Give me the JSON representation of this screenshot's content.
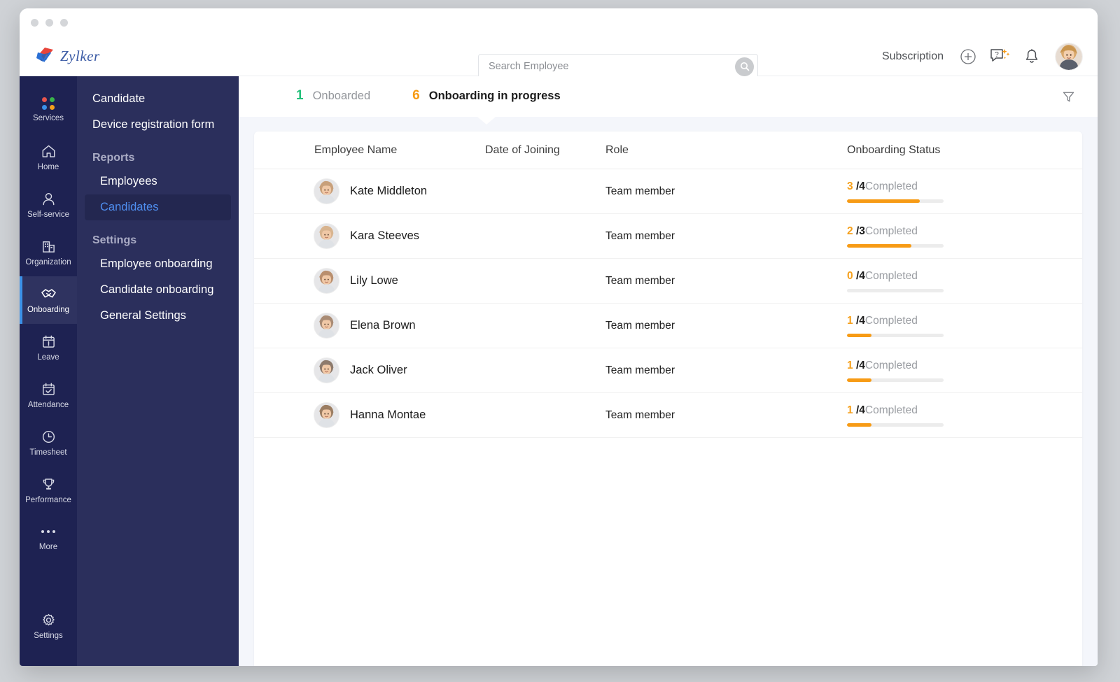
{
  "window": {
    "dots": 3
  },
  "brand": {
    "name": "Zylker"
  },
  "header": {
    "search": {
      "placeholder": "Search Employee",
      "value": ""
    },
    "subscription_label": "Subscription",
    "icons": [
      "add-icon",
      "help-icon",
      "notification-bell-icon",
      "user-avatar"
    ]
  },
  "rail": {
    "items": [
      {
        "label": "Services",
        "icon": "services-grid-icon",
        "active": false
      },
      {
        "label": "Home",
        "icon": "home-icon",
        "active": false
      },
      {
        "label": "Self-service",
        "icon": "user-icon",
        "active": false
      },
      {
        "label": "Organization",
        "icon": "building-icon",
        "active": false
      },
      {
        "label": "Onboarding",
        "icon": "handshake-icon",
        "active": true
      },
      {
        "label": "Leave",
        "icon": "calendar-alert-icon",
        "active": false
      },
      {
        "label": "Attendance",
        "icon": "calendar-check-icon",
        "active": false
      },
      {
        "label": "Timesheet",
        "icon": "clock-icon",
        "active": false
      },
      {
        "label": "Performance",
        "icon": "trophy-icon",
        "active": false
      },
      {
        "label": "More",
        "icon": "ellipsis-icon",
        "active": false
      }
    ],
    "bottom": {
      "label": "Settings",
      "icon": "gear-icon"
    },
    "accent_color": "#3b91e8",
    "background": "#1e2252"
  },
  "submenu": {
    "links": [
      {
        "label": "Candidate"
      },
      {
        "label": "Device registration form"
      }
    ],
    "groups": [
      {
        "title": "Reports",
        "children": [
          {
            "label": "Employees",
            "active": false
          },
          {
            "label": "Candidates",
            "active": true
          }
        ]
      },
      {
        "title": "Settings",
        "children": [
          {
            "label": "Employee onboarding",
            "active": false
          },
          {
            "label": "Candidate onboarding",
            "active": false
          },
          {
            "label": "General Settings",
            "active": false
          }
        ]
      }
    ]
  },
  "tabs": [
    {
      "count": "1",
      "label": "Onboarded",
      "active": false,
      "count_color": "#22c07a"
    },
    {
      "count": "6",
      "label": "Onboarding in progress",
      "active": true,
      "count_color": "#f79b15"
    }
  ],
  "toolbar": {
    "filter_icon": "filter-funnel-icon"
  },
  "table": {
    "columns": [
      "Employee Name",
      "Date of Joining",
      "Role",
      "Onboarding Status"
    ],
    "completed_word": "Completed",
    "rows": [
      {
        "name": "Kate Middleton",
        "date": "",
        "role": "Team member",
        "done": "3",
        "total": "4",
        "percent": 75,
        "avatar": "#c8a07a"
      },
      {
        "name": "Kara Steeves",
        "date": "",
        "role": "Team member",
        "done": "2",
        "total": "3",
        "percent": 67,
        "avatar": "#d8b48f"
      },
      {
        "name": "Lily Lowe",
        "date": "",
        "role": "Team member",
        "done": "0",
        "total": "4",
        "percent": 0,
        "avatar": "#b98f6e"
      },
      {
        "name": "Elena Brown",
        "date": "",
        "role": "Team member",
        "done": "1",
        "total": "4",
        "percent": 25,
        "avatar": "#a98b74"
      },
      {
        "name": "Jack Oliver",
        "date": "",
        "role": "Team member",
        "done": "1",
        "total": "4",
        "percent": 25,
        "avatar": "#8d7a6c"
      },
      {
        "name": "Hanna Montae",
        "date": "",
        "role": "Team member",
        "done": "1",
        "total": "4",
        "percent": 25,
        "avatar": "#9b7d62"
      }
    ]
  },
  "colors": {
    "orange": "#f79b15",
    "green": "#22c07a",
    "blue_accent": "#4f8ff0",
    "sidebar": "#1e2252",
    "submenu": "#2b2f5c",
    "page_bg": "#f4f6fb"
  }
}
